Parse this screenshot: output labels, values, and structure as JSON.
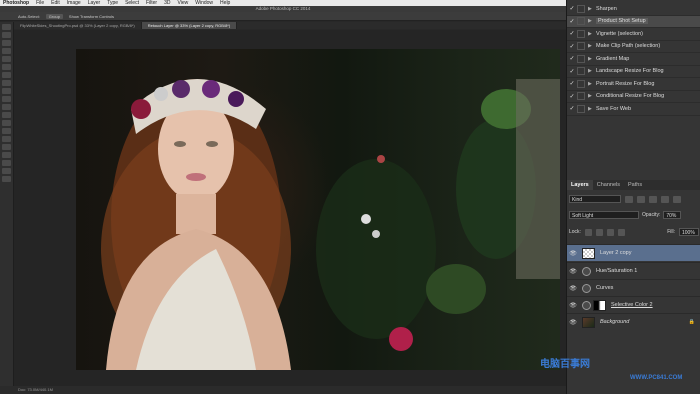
{
  "menubar": {
    "app": "Photoshop",
    "items": [
      "File",
      "Edit",
      "Image",
      "Layer",
      "Type",
      "Select",
      "Filter",
      "3D",
      "View",
      "Window",
      "Help"
    ]
  },
  "window_title": "Adobe Photoshop CC 2014",
  "options_bar": {
    "auto_select": "Auto-Select:",
    "group": "Group",
    "show_transform": "Show Transform Controls"
  },
  "doc_tabs": [
    {
      "label": "FlipWhiteSkies_ShootingPro.psd @ 33% (Layer 2 copy, RGB/8*)",
      "active": false
    },
    {
      "label": "Retouch Layer @ 33% (Layer 2 copy, RGB/8*)",
      "active": true
    }
  ],
  "status": "Doc: 73.0M/440.1M",
  "actions": [
    {
      "label": "Sharpen",
      "active": false
    },
    {
      "label": "Product Shot Setup",
      "active": true
    },
    {
      "label": "Vignette (selection)",
      "active": false
    },
    {
      "label": "Make Clip Path (selection)",
      "active": false
    },
    {
      "label": "Gradient Map",
      "active": false
    },
    {
      "label": "Landscape Resize For Blog",
      "active": false
    },
    {
      "label": "Portrait Resize For Blog",
      "active": false
    },
    {
      "label": "Conditional Resize For Blog",
      "active": false
    },
    {
      "label": "Save For Web",
      "active": false
    }
  ],
  "layers_panel": {
    "tabs": [
      "Layers",
      "Channels",
      "Paths"
    ],
    "kind_label": "Kind",
    "blend_mode": "Soft Light",
    "opacity_label": "Opacity:",
    "opacity_value": "70%",
    "lock_label": "Lock:",
    "fill_label": "Fill:",
    "fill_value": "100%",
    "layers": [
      {
        "name": "Layer 2 copy",
        "selected": true
      },
      {
        "name": "Hue/Saturation 1",
        "selected": false
      },
      {
        "name": "Curves",
        "selected": false
      },
      {
        "name": "Selective Color 2",
        "selected": false
      },
      {
        "name": "Background",
        "selected": false
      }
    ]
  },
  "watermark": {
    "line1": "电脑百事网",
    "line2": "WWW.PC841.COM"
  }
}
